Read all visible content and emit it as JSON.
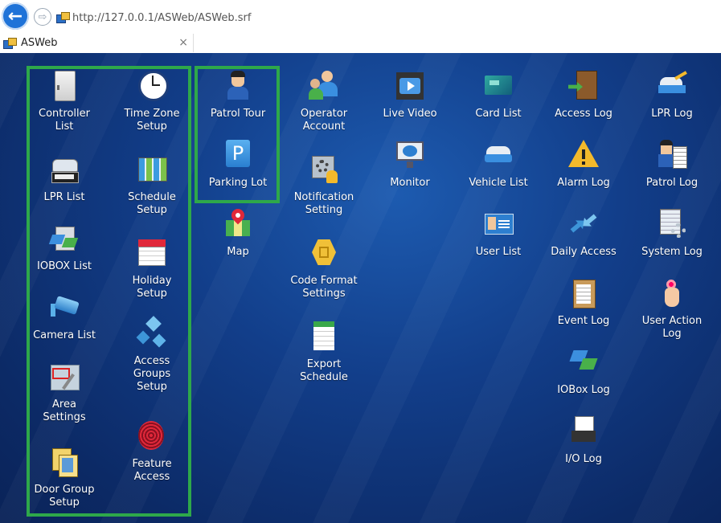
{
  "browser": {
    "url": "http://127.0.0.1/ASWeb/ASWeb.srf",
    "tab_title": "ASWeb",
    "tab_close": "×"
  },
  "tiles": {
    "controller_list": "Controller\nList",
    "time_zone_setup": "Time Zone\nSetup",
    "lpr_list": "LPR List",
    "schedule_setup": "Schedule\nSetup",
    "iobox_list": "IOBOX List",
    "holiday_setup": "Holiday\nSetup",
    "camera_list": "Camera List",
    "access_groups_setup": "Access\nGroups\nSetup",
    "area_settings": "Area\nSettings",
    "feature_access": "Feature\nAccess",
    "door_group_setup": "Door Group\nSetup",
    "patrol_tour": "Patrol Tour",
    "parking_lot": "Parking Lot",
    "map": "Map",
    "operator_account": "Operator\nAccount",
    "notification_setting": "Notification\nSetting",
    "code_format_settings": "Code Format\nSettings",
    "export_schedule": "Export\nSchedule",
    "live_video": "Live Video",
    "monitor": "Monitor",
    "card_list": "Card List",
    "vehicle_list": "Vehicle List",
    "user_list": "User List",
    "access_log": "Access Log",
    "alarm_log": "Alarm Log",
    "daily_access": "Daily Access",
    "event_log": "Event Log",
    "iobox_log": "IOBox Log",
    "io_log": "I/O Log",
    "lpr_log": "LPR Log",
    "patrol_log": "Patrol Log",
    "system_log": "System Log",
    "user_action_log": "User Action\nLog"
  },
  "icons": {
    "parking_letter": "P",
    "back_arrow": "←",
    "forward_arrow": "⇨"
  },
  "colors": {
    "highlight_border": "#2ea84a",
    "desktop_bg": "#123e8a",
    "back_button": "#1f73d8"
  }
}
